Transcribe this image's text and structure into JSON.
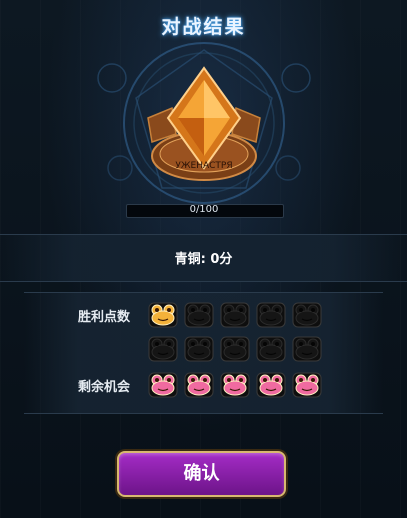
{
  "title": "对战结果",
  "emblem": {
    "text": "УЖЕНАСТРЯ",
    "icon": "bronze-rank-emblem"
  },
  "progress": {
    "text": "0/100",
    "fraction": 0
  },
  "rank": {
    "text": "青铜: 0分"
  },
  "wins": {
    "label": "胜利点数",
    "total": 10,
    "earned": 1
  },
  "chances": {
    "label": "剩余机会",
    "total": 5,
    "remaining": 5
  },
  "confirm_label": "确认",
  "colors": {
    "accent": "#a42cc6",
    "gold": "#f5b44c",
    "frog_pink": "#f06aa0",
    "frog_dark": "#151515"
  }
}
